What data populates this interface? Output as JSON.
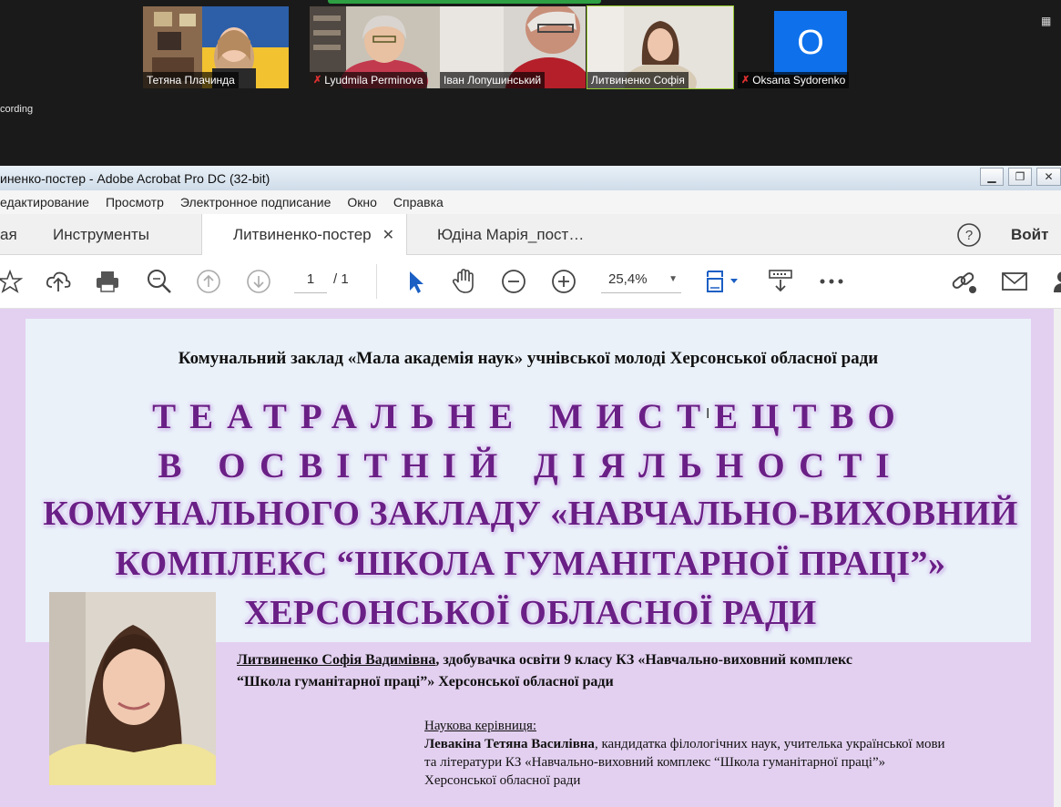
{
  "zoom": {
    "recording_label": "cording",
    "participants": [
      {
        "name": "Тетяна Плачинда",
        "muted": false
      },
      {
        "name": "Lyudmila Perminova",
        "muted": true
      },
      {
        "name": "Іван Лопушинський",
        "muted": false
      },
      {
        "name": "Литвиненко Софія",
        "muted": false
      },
      {
        "name": "Oksana Sydorenko",
        "muted": true,
        "avatar_letter": "O"
      }
    ],
    "colors": {
      "bg": "#1a1a1a",
      "active_border": "#9acd32",
      "avatar": "#0e71eb"
    }
  },
  "acrobat": {
    "title": "иненко-постер - Adobe Acrobat Pro DC (32-bit)",
    "menu": [
      "едактирование",
      "Просмотр",
      "Электронное подписание",
      "Окно",
      "Справка"
    ],
    "tabs": {
      "home": "ая",
      "tools": "Инструменты",
      "active_doc": "Литвиненко-постер",
      "other_doc": "Юдіна Марія_пост…",
      "signin": "Войт"
    },
    "toolbar": {
      "page_current": "1",
      "page_total": "/ 1",
      "zoom": "25,4%"
    },
    "icons": [
      "star-icon",
      "cloud-upload-icon",
      "print-icon",
      "zoom-search-icon",
      "page-up-icon",
      "page-down-icon",
      "select-cursor-icon",
      "hand-icon",
      "zoom-out-icon",
      "zoom-in-icon",
      "fit-page-icon",
      "scroll-mode-icon",
      "more-icon",
      "link-icon",
      "mail-icon",
      "help-icon"
    ]
  },
  "poster": {
    "org": "Комунальний заклад «Мала академія наук» учнівської молоді Херсонської обласної ради",
    "line1": "ТЕАТРАЛЬНЕ МИСТЕЦТВО",
    "line2": "В ОСВІТНІЙ ДІЯЛЬНОСТІ",
    "line3": "КОМУНАЛЬНОГО ЗАКЛАДУ «НАВЧАЛЬНО-ВИХОВНИЙ",
    "line4": "КОМПЛЕКС “ШКОЛА ГУМАНІТАРНОЇ ПРАЦІ”»",
    "line5": "ХЕРСОНСЬКОЇ ОБЛАСНОЇ РАДИ",
    "author_name": "Литвиненко Софія Вадимівна",
    "author_rest_1": ", здобувачка освіти 9 класу КЗ «Навчально-виховний комплекс",
    "author_rest_2": "“Школа гуманітарної праці”» Херсонської обласної ради",
    "supervisor_label": "Наукова керівниця:",
    "supervisor_name": "Левакіна Тетяна Василівна",
    "supervisor_rest_1": ", кандидатка філологічних наук, учителька української мови",
    "supervisor_rest_2": "та літератури КЗ «Навчально-виховний комплекс “Школа гуманітарної праці”»",
    "supervisor_rest_3": "Херсонської обласної ради",
    "colors": {
      "title": "#6a1f86",
      "bg": "#e3d0f0",
      "panel": "#eaf1f9"
    }
  }
}
